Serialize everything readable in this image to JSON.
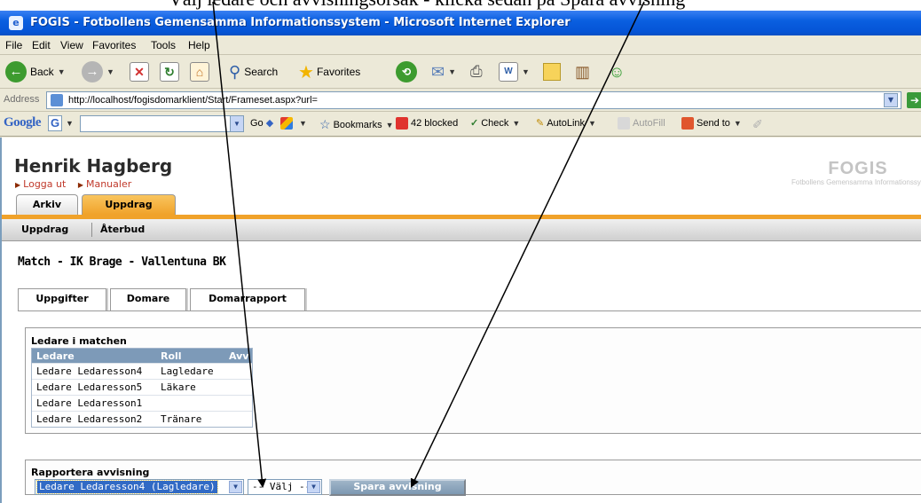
{
  "caption": {
    "text": "Välj ledare och avvisningsorsak - klicka sedan på Spara avvisning"
  },
  "window": {
    "title": "FOGIS - Fotbollens Gemensamma Informationssystem - Microsoft Internet Explorer"
  },
  "menu": [
    "File",
    "Edit",
    "View",
    "Favorites",
    "Tools",
    "Help"
  ],
  "toolbar": {
    "back": "Back",
    "search": "Search",
    "favorites": "Favorites"
  },
  "address": {
    "label": "Address",
    "url": "http://localhost/fogisdomarklient/Start/Frameset.aspx?url="
  },
  "google": {
    "logo": "Google",
    "search_prefix": "G",
    "go": "Go",
    "bookmarks": "Bookmarks",
    "blocked": "42 blocked",
    "check": "Check",
    "autolink": "AutoLink",
    "autofill": "AutoFill",
    "sendto": "Send to"
  },
  "header": {
    "user_name": "Henrik Hagberg",
    "links": [
      "Logga ut",
      "Manualer"
    ],
    "logo_title": "FOGIS",
    "logo_subtitle": "Fotbollens Gemensamma Informationssystem"
  },
  "main_tabs": [
    {
      "label": "Arkiv",
      "active": false
    },
    {
      "label": "Uppdrag",
      "active": true
    }
  ],
  "sub_nav": [
    "Uppdrag",
    "Återbud"
  ],
  "match": {
    "title": "Match - IK Brage - Vallentuna BK"
  },
  "page_tabs": [
    "Uppgifter",
    "Domare",
    "Domarrapport"
  ],
  "ledare_panel": {
    "title": "Ledare i matchen",
    "columns": [
      "Ledare",
      "Roll",
      "Avv"
    ],
    "rows": [
      {
        "ledare": "Ledare Ledaresson4",
        "roll": "Lagledare",
        "avv": ""
      },
      {
        "ledare": "Ledare Ledaresson5",
        "roll": "Läkare",
        "avv": ""
      },
      {
        "ledare": "Ledare Ledaresson1",
        "roll": "",
        "avv": ""
      },
      {
        "ledare": "Ledare Ledaresson2",
        "roll": "Tränare",
        "avv": ""
      }
    ]
  },
  "avvisning_panel": {
    "title": "Rapportera avvisning",
    "leader_select": "Ledare Ledaresson4 (Lagledare)",
    "reason_select": "-- Välj --",
    "save_button": "Spara avvisning"
  },
  "colors": {
    "titlebar_blue": "#0554d6",
    "tab_active_orange": "#f0a22a",
    "grid_header": "#7d9ab8",
    "selection_blue": "#316ac5"
  }
}
